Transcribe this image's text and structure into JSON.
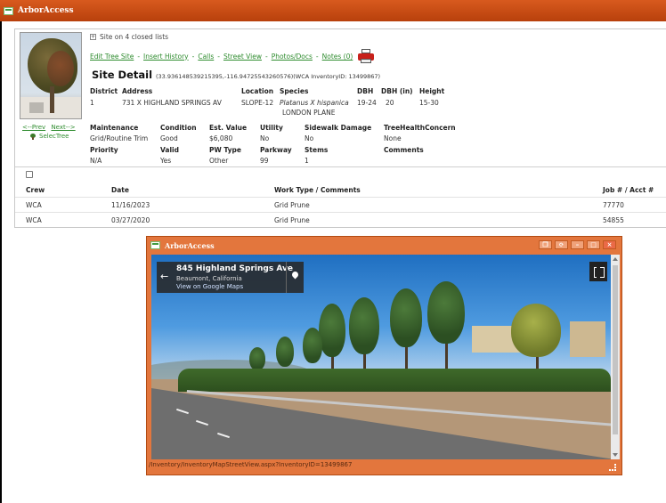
{
  "app": {
    "title": "ArborAccess"
  },
  "site": {
    "closed_lists": "Site on 4 closed lists",
    "links": [
      "Edit Tree Site",
      "Insert History",
      "Calls",
      "Street View",
      "Photos/Docs",
      "Notes (0)"
    ],
    "heading": "Site Detail",
    "coords": "(33.936148539215395,-116.94725543260576)(WCA InventoryID: 13499867)",
    "nav_prev": "<--Prev",
    "nav_next": "Next-->",
    "selectree": "SelecTree",
    "labels": {
      "district": "District",
      "address": "Address",
      "location": "Location",
      "species": "Species",
      "dbh": "DBH",
      "dbh_in": "DBH (in)",
      "height": "Height",
      "maintenance": "Maintenance",
      "condition": "Condition",
      "est_value": "Est. Value",
      "utility": "Utility",
      "sidewalk_damage": "Sidewalk Damage",
      "tree_health_concern": "TreeHealthConcern",
      "priority": "Priority",
      "valid": "Valid",
      "pw_type": "PW Type",
      "parkway": "Parkway",
      "stems": "Stems",
      "comments": "Comments"
    },
    "values": {
      "district": "1",
      "address": "731 X HIGHLAND SPRINGS AV",
      "location": "SLOPE-12",
      "species_latin": "Platanus X hispanica",
      "species_common": "LONDON PLANE",
      "dbh": "19-24",
      "dbh_in": "20",
      "height": "15-30",
      "maintenance": "Grid/Routine Trim",
      "condition": "Good",
      "est_value": "$6,080",
      "utility": "No",
      "sidewalk_damage": "No",
      "tree_health_concern": "None",
      "priority": "N/A",
      "valid": "Yes",
      "pw_type": "Other",
      "parkway": "99",
      "stems": "1",
      "comments": ""
    }
  },
  "history": {
    "columns": [
      "Crew",
      "Date",
      "Work Type / Comments",
      "Job # / Acct #"
    ],
    "rows": [
      [
        "WCA",
        "11/16/2023",
        "Grid Prune",
        "77770"
      ],
      [
        "WCA",
        "03/27/2020",
        "Grid Prune",
        "54855"
      ]
    ]
  },
  "popup": {
    "title": "ArborAccess",
    "buttons": [
      "❒",
      "⟳",
      "–",
      "□",
      "×"
    ],
    "streetview": {
      "address": "845 Highland Springs Ave",
      "city": "Beaumont, California",
      "link": "View on Google Maps"
    },
    "status_url": "/Inventory/InventoryMapStreetView.aspx?InventoryID=13499867"
  }
}
